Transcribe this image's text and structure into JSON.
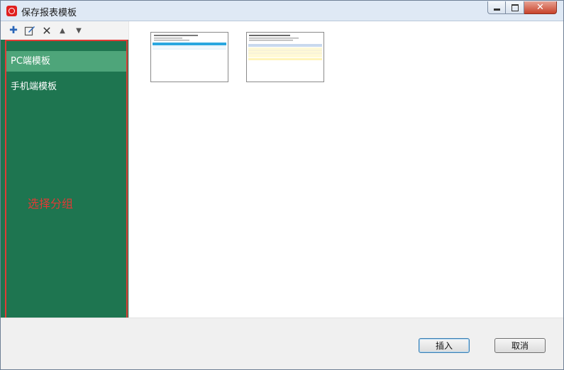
{
  "window": {
    "title": "保存报表模板"
  },
  "toolbar": {
    "icons": [
      "add-icon",
      "edit-icon",
      "delete-icon",
      "move-up-icon",
      "move-down-icon"
    ],
    "glyphs": {
      "add": "✚",
      "delete": "✕",
      "up": "▲",
      "down": "▼"
    }
  },
  "sidebar": {
    "items": [
      {
        "label": "PC端模板",
        "selected": true
      },
      {
        "label": "手机端模板",
        "selected": false
      }
    ],
    "annotation": "选择分组"
  },
  "buttons": {
    "insert": "插入",
    "cancel": "取消"
  },
  "colors": {
    "sidebar_bg": "#1e7550",
    "selected_bg": "#4ea57a",
    "annotation": "#e23a35"
  }
}
